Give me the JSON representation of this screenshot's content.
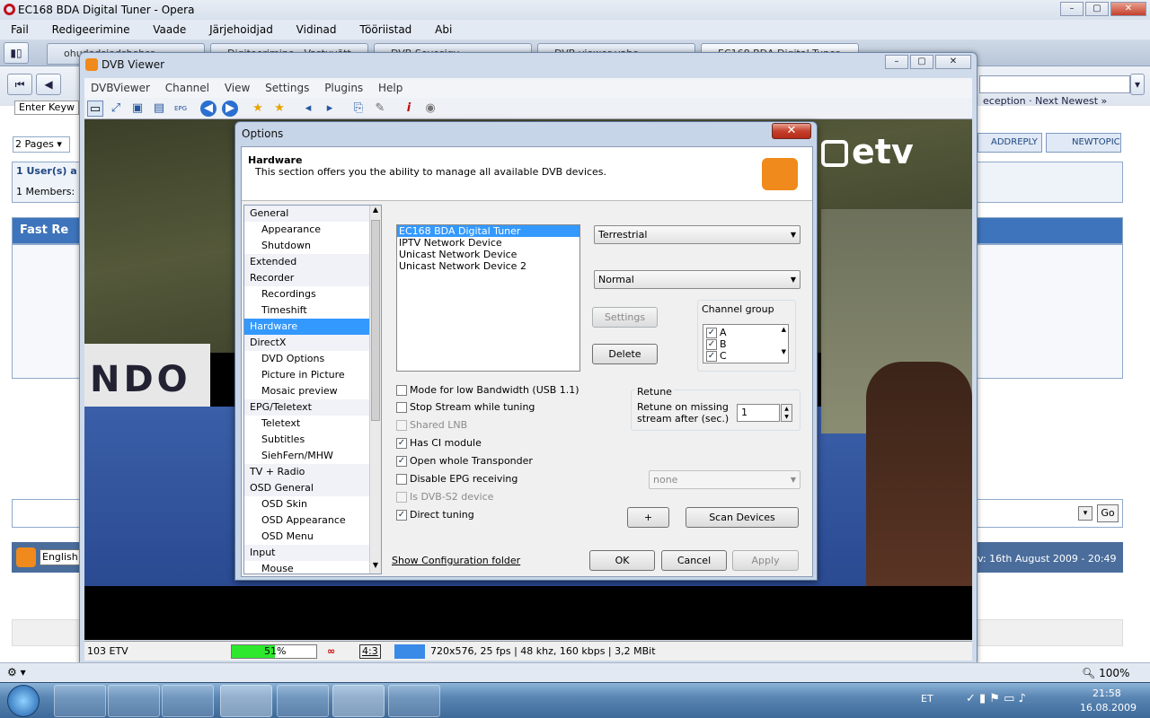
{
  "opera": {
    "title": "EC168 BDA Digital Tuner - Opera",
    "menu": [
      "Fail",
      "Redigeerimine",
      "Vaade",
      "Järjehoidjad",
      "Vidinad",
      "Tööriistad",
      "Abi"
    ],
    "tabs": [
      "ohudodsjodshohss",
      "Digiteerimine - Vastuvõtt",
      "DVB Sevesigv...",
      "DVB viewer vahe...",
      "EC168 BDA Digital Tuner"
    ],
    "address_placeholder": "Enter Keyw",
    "zoom": "100%"
  },
  "forum": {
    "pages_label": "2 Pages",
    "users_label": "1 User(s) a",
    "members_label": "1 Members:",
    "fast_reply": "Fast Re",
    "reception_link": "eception · Next Newest »",
    "addreply": "ADDREPLY",
    "newtopic": "NEWTOPIC",
    "go_button": "Go",
    "language": "English",
    "date_info": "v: 16th August 2009 - 20:49"
  },
  "dvb": {
    "title": "DVB Viewer",
    "menu": [
      "DVBViewer",
      "Channel",
      "View",
      "Settings",
      "Plugins",
      "Help"
    ],
    "channel_logo": "etv",
    "status": {
      "channel": "103 ETV",
      "signal": "51%",
      "signal_level": 0.51,
      "aspect": "4:3",
      "info": "720x576, 25 fps | 48 khz, 160 kbps | 3,2 MBit"
    }
  },
  "options": {
    "title": "Options",
    "section_title": "Hardware",
    "section_desc": "This section offers you the ability to manage all available DVB devices.",
    "tree": [
      {
        "label": "General",
        "level": 0
      },
      {
        "label": "Appearance",
        "level": 1
      },
      {
        "label": "Shutdown",
        "level": 1
      },
      {
        "label": "Extended",
        "level": 0
      },
      {
        "label": "Recorder",
        "level": 0
      },
      {
        "label": "Recordings",
        "level": 1
      },
      {
        "label": "Timeshift",
        "level": 1
      },
      {
        "label": "Hardware",
        "level": 0,
        "selected": true
      },
      {
        "label": "DirectX",
        "level": 0
      },
      {
        "label": "DVD Options",
        "level": 1
      },
      {
        "label": "Picture in Picture",
        "level": 1
      },
      {
        "label": "Mosaic preview",
        "level": 1
      },
      {
        "label": "EPG/Teletext",
        "level": 0
      },
      {
        "label": "Teletext",
        "level": 1
      },
      {
        "label": "Subtitles",
        "level": 1
      },
      {
        "label": "SiehFern/MHW",
        "level": 1
      },
      {
        "label": "TV + Radio",
        "level": 0
      },
      {
        "label": "OSD General",
        "level": 0
      },
      {
        "label": "OSD Skin",
        "level": 1
      },
      {
        "label": "OSD Appearance",
        "level": 1
      },
      {
        "label": "OSD Menu",
        "level": 1
      },
      {
        "label": "Input",
        "level": 0
      },
      {
        "label": "Mouse",
        "level": 1
      }
    ],
    "devices": [
      "EC168 BDA Digital Tuner",
      "IPTV Network Device",
      "Unicast Network Device",
      "Unicast Network Device 2"
    ],
    "type_select": "Terrestrial",
    "mode_select": "Normal",
    "settings_btn": "Settings",
    "delete_btn": "Delete",
    "channel_group_label": "Channel group",
    "channel_groups": [
      "A",
      "B",
      "C"
    ],
    "retune_label": "Retune",
    "retune_desc": "Retune on missing stream after (sec.)",
    "retune_value": "1",
    "checkboxes": [
      {
        "label": "Mode for low Bandwidth (USB 1.1)",
        "checked": false,
        "disabled": false
      },
      {
        "label": "Stop Stream while tuning",
        "checked": false,
        "disabled": false
      },
      {
        "label": "Shared LNB",
        "checked": false,
        "disabled": true
      },
      {
        "label": "Has CI module",
        "checked": true,
        "disabled": false
      },
      {
        "label": "Open whole Transponder",
        "checked": true,
        "disabled": false
      },
      {
        "label": "Disable EPG receiving",
        "checked": false,
        "disabled": false
      },
      {
        "label": "Is DVB-S2 device",
        "checked": false,
        "disabled": true
      },
      {
        "label": "Direct tuning",
        "checked": true,
        "disabled": false
      }
    ],
    "epg_select": "none",
    "plus_btn": "+",
    "scan_btn": "Scan Devices",
    "config_link": "Show Configuration folder",
    "ok_btn": "OK",
    "cancel_btn": "Cancel",
    "apply_btn": "Apply"
  },
  "taskbar": {
    "lang": "ET",
    "time": "21:58",
    "date": "16.08.2009"
  }
}
